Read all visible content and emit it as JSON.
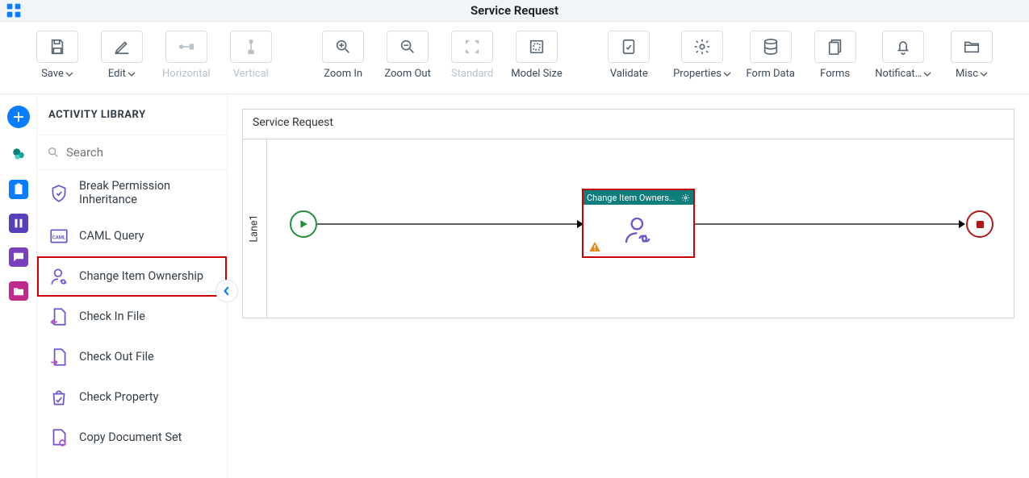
{
  "header": {
    "title": "Service Request"
  },
  "toolbar": {
    "save": "Save",
    "edit": "Edit",
    "horizontal": "Horizontal",
    "vertical": "Vertical",
    "zoom_in": "Zoom In",
    "zoom_out": "Zoom Out",
    "standard": "Standard",
    "model_size": "Model Size",
    "validate": "Validate",
    "properties": "Properties",
    "form_data": "Form Data",
    "forms": "Forms",
    "notifications": "Notificat…",
    "misc": "Misc"
  },
  "sidebar": {
    "title": "ACTIVITY LIBRARY",
    "search_placeholder": "Search",
    "items": [
      {
        "label": "Break Permission Inheritance"
      },
      {
        "label": "CAML Query"
      },
      {
        "label": "Change Item Ownership"
      },
      {
        "label": "Check In File"
      },
      {
        "label": "Check Out File"
      },
      {
        "label": "Check Property"
      },
      {
        "label": "Copy Document Set"
      }
    ]
  },
  "canvas": {
    "pool_title": "Service Request",
    "lane_label": "Lane1",
    "activity_title": "Change Item Ownershi..."
  },
  "colors": {
    "accent": "#0a7cff",
    "teal": "#0e7d7b",
    "highlight_red": "#cc0000",
    "start_green": "#1f8f3a",
    "end_red": "#b01818",
    "warn": "#e08a1a"
  }
}
